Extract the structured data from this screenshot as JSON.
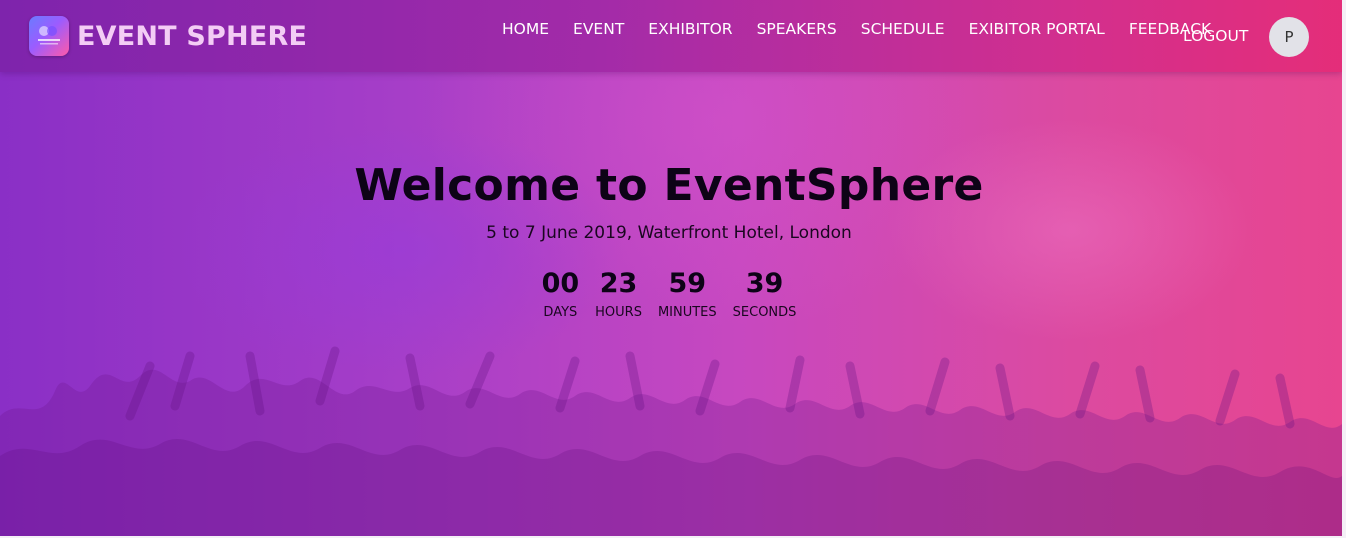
{
  "brand": {
    "name": "EVENT SPHERE",
    "logo_text": "EVENT SPHERE",
    "logo_icon": "event-sphere-logo"
  },
  "nav": {
    "items": [
      {
        "label": "HOME"
      },
      {
        "label": "EVENT"
      },
      {
        "label": "EXHIBITOR"
      },
      {
        "label": "SPEAKERS"
      },
      {
        "label": "SCHEDULE"
      },
      {
        "label": "EXIBITOR PORTAL"
      },
      {
        "label": "FEEDBACK"
      }
    ],
    "logout_label": "LOGOUT",
    "avatar_initial": "P"
  },
  "hero": {
    "title": "Welcome to EventSphere",
    "subtitle": "5 to 7 June 2019, Waterfront Hotel, London"
  },
  "countdown": {
    "days": {
      "value": "00",
      "label": "DAYS"
    },
    "hours": {
      "value": "23",
      "label": "HOURS"
    },
    "minutes": {
      "value": "59",
      "label": "MINUTES"
    },
    "seconds": {
      "value": "39",
      "label": "SECONDS"
    }
  },
  "colors": {
    "gradient_start": "#8a2fc6",
    "gradient_end": "#e74590",
    "brand_text": "#f3cdf5"
  }
}
